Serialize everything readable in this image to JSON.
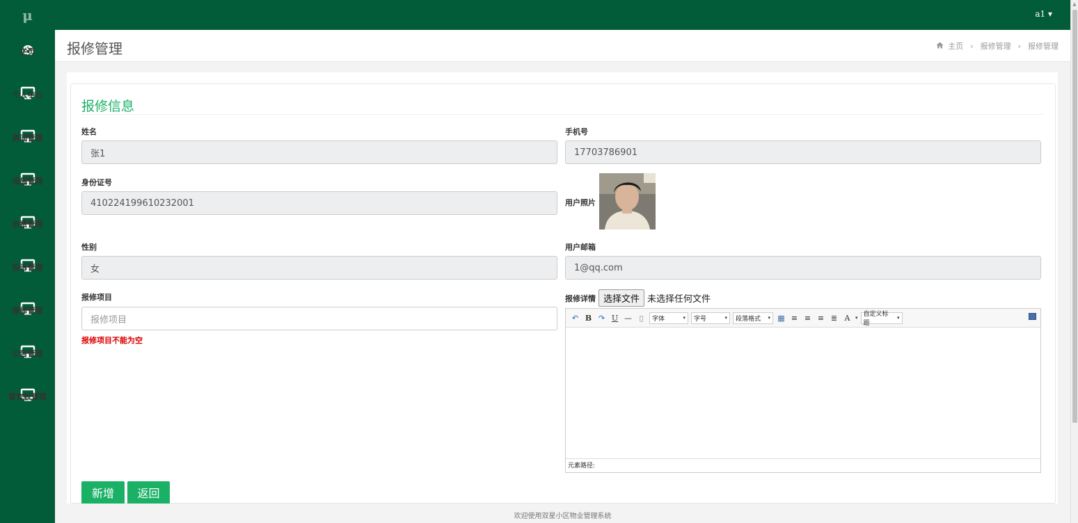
{
  "app": {
    "logo": "μ",
    "user_menu": "a1 ▾"
  },
  "sidebar": {
    "items": [
      {
        "label": "主页",
        "icon": "dashboard-icon"
      },
      {
        "label": "个人中心",
        "icon": "monitor-icon"
      },
      {
        "label": "房间管理",
        "icon": "monitor-icon"
      },
      {
        "label": "设施管理",
        "icon": "monitor-icon"
      },
      {
        "label": "收费管理",
        "icon": "monitor-icon"
      },
      {
        "label": "投诉管理",
        "icon": "monitor-icon"
      },
      {
        "label": "报修管理",
        "icon": "monitor-icon"
      },
      {
        "label": "公告管理",
        "icon": "monitor-icon"
      },
      {
        "label": "留言板管理",
        "icon": "monitor-icon"
      }
    ]
  },
  "header": {
    "title": "报修管理",
    "breadcrumb": [
      "主页",
      "报修管理",
      "报修管理"
    ]
  },
  "form": {
    "section_title": "报修信息",
    "name_label": "姓名",
    "name_value": "张1",
    "phone_label": "手机号",
    "phone_value": "17703786901",
    "idcard_label": "身份证号",
    "idcard_value": "410224199610232001",
    "photo_label": "用户照片",
    "gender_label": "性别",
    "gender_value": "女",
    "email_label": "用户邮箱",
    "email_value": "1@qq.com",
    "item_label": "报修项目",
    "item_placeholder": "报修项目",
    "item_error": "报修项目不能为空",
    "detail_label": "报修详情",
    "file_button": "选择文件",
    "file_none": "未选择任何文件"
  },
  "editor": {
    "font_family": "字体",
    "font_size": "字号",
    "paragraph": "段落格式",
    "custom_title": "自定义标题",
    "path_label": "元素路径:"
  },
  "actions": {
    "add": "新增",
    "back": "返回"
  },
  "footer": {
    "text": "欢迎使用双星小区物业管理系统"
  },
  "colors": {
    "sidebar": "#035c39",
    "accent": "#1ab166",
    "error": "#dd0000"
  }
}
